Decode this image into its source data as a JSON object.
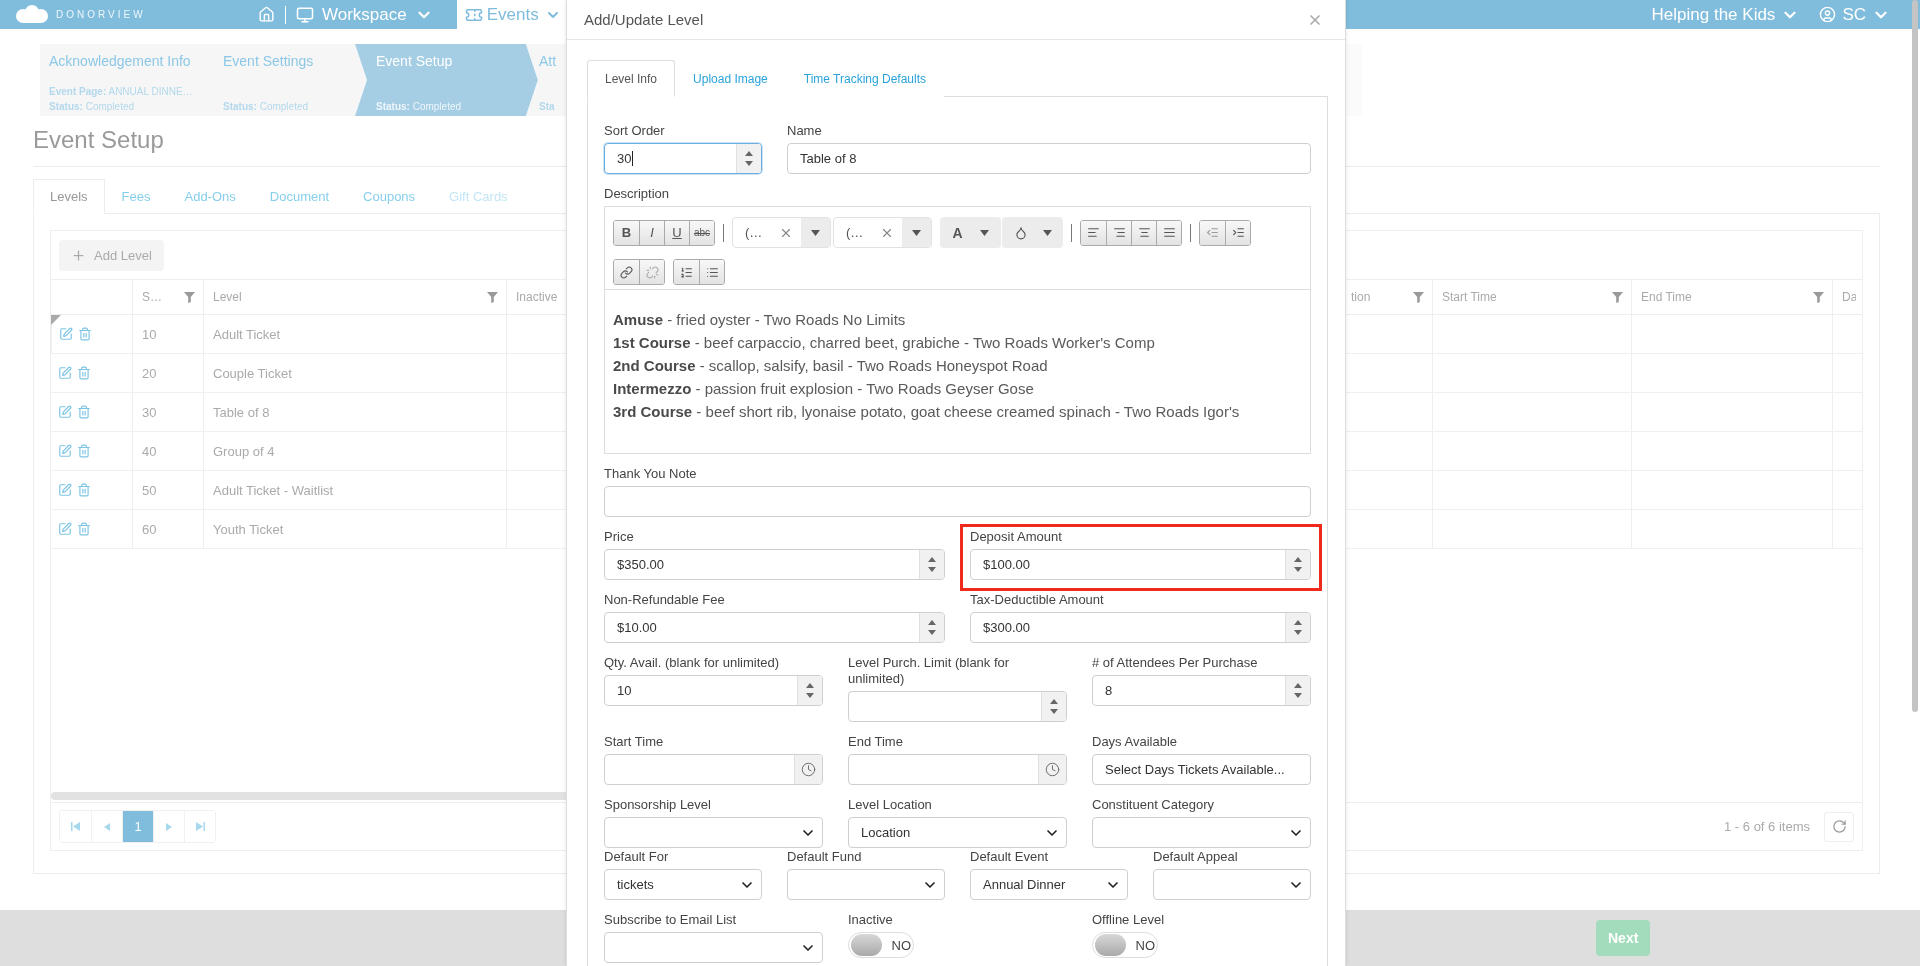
{
  "top_bar": {
    "logo": "DONORVIEW",
    "workspace": "Workspace",
    "events": "Events",
    "organization": "Helping the Kids",
    "user": "SC"
  },
  "wizard": [
    {
      "title": "Acknowledgement Info",
      "details": [
        {
          "label": "Event Page:",
          "value": "ANNUAL DINNE…"
        },
        {
          "label": "Status:",
          "value": "Completed"
        }
      ],
      "selected": false
    },
    {
      "title": "Event Settings",
      "details": [
        {
          "label": "Status:",
          "value": "Completed"
        }
      ],
      "selected": false
    },
    {
      "title": "Event Setup",
      "details": [
        {
          "label": "Status:",
          "value": "Completed"
        }
      ],
      "selected": true
    },
    {
      "title": "Att",
      "details": [
        {
          "label": "Sta"
        }
      ],
      "selected": false
    }
  ],
  "page_title": "Event Setup",
  "tabs": [
    {
      "label": "Levels",
      "selected": true,
      "disabled": false
    },
    {
      "label": "Fees",
      "selected": false,
      "disabled": false
    },
    {
      "label": "Add-Ons",
      "selected": false,
      "disabled": false
    },
    {
      "label": "Document",
      "selected": false,
      "disabled": false
    },
    {
      "label": "Coupons",
      "selected": false,
      "disabled": false
    },
    {
      "label": "Gift Cards",
      "selected": false,
      "disabled": true
    }
  ],
  "add_button": "Add Level",
  "table": {
    "columns": [
      {
        "label": "S…",
        "filter": true
      },
      {
        "label": "Level",
        "filter": true
      },
      {
        "label": "Inactive"
      },
      {
        "label": "tion",
        "filter": true
      },
      {
        "label": "Start Time",
        "filter": true
      },
      {
        "label": "End Time",
        "filter": true
      },
      {
        "label": "Da"
      }
    ],
    "rows": [
      {
        "sort": "10",
        "level": "Adult Ticket",
        "marked": true
      },
      {
        "sort": "20",
        "level": "Couple Ticket",
        "marked": false
      },
      {
        "sort": "30",
        "level": "Table of 8",
        "marked": false
      },
      {
        "sort": "40",
        "level": "Group of 4",
        "marked": false
      },
      {
        "sort": "50",
        "level": "Adult Ticket - Waitlist",
        "marked": false
      },
      {
        "sort": "60",
        "level": "Youth Ticket",
        "marked": false
      }
    ]
  },
  "pager": {
    "pages": [
      {
        "label": "1",
        "selected": true
      }
    ],
    "summary": "1 - 6 of 6 items"
  },
  "footer": {
    "next_button": "Next"
  },
  "modal": {
    "title": "Add/Update Level",
    "tabs": [
      {
        "label": "Level Info",
        "selected": true
      },
      {
        "label": "Upload Image",
        "selected": false
      },
      {
        "label": "Time Tracking Defaults",
        "selected": false
      }
    ],
    "rows": [
      [
        {
          "kind": "number",
          "label": "Sort Order",
          "value": "30",
          "focused": true,
          "highlighted": false
        },
        {
          "kind": "text",
          "label": "Name",
          "value": "Table of 8",
          "focused": false,
          "highlighted": false
        }
      ],
      [
        {
          "kind": "editor",
          "label": "Description",
          "toolbar": {
            "format": [
              "B",
              "I",
              "U",
              "abc"
            ],
            "font_name": "(…",
            "font_size": "(…",
            "font_color": "A"
          },
          "lines": [
            "**Amuse** - fried oyster - Two Roads No Limits",
            "**1st Course** - beef carpaccio, charred beet, grabiche - Two Roads Worker's Comp",
            "**2nd Course** - scallop, salsify, basil - Two Roads Honeyspot Road",
            "**Intermezzo** - passion fruit explosion - Two Roads Geyser Gose",
            "**3rd Course** - beef short rib, lyonaise potato, goat cheese creamed spinach - Two Roads Igor's"
          ]
        }
      ],
      [
        {
          "kind": "text",
          "label": "Thank You Note",
          "focused": false,
          "highlighted": false
        }
      ],
      [
        {
          "kind": "number",
          "label": "Price",
          "value": "$350.00",
          "focused": false,
          "highlighted": false
        },
        {
          "kind": "number",
          "label": "Deposit Amount",
          "value": "$100.00",
          "focused": false,
          "highlighted": true
        }
      ],
      [
        {
          "kind": "number",
          "label": "Non-Refundable Fee",
          "value": "$10.00",
          "focused": false,
          "highlighted": false
        },
        {
          "kind": "number",
          "label": "Tax-Deductible Amount",
          "value": "$300.00",
          "focused": false,
          "highlighted": false
        }
      ],
      [
        {
          "kind": "number",
          "label": "Qty. Avail. (blank for unlimited)",
          "value": "10",
          "focused": false,
          "highlighted": false
        },
        {
          "kind": "number",
          "label": "Level Purch. Limit (blank for unlimited)",
          "focused": false,
          "highlighted": false
        },
        {
          "kind": "number",
          "label": "# of Attendees Per Purchase",
          "value": "8",
          "focused": false,
          "highlighted": false
        }
      ],
      [
        {
          "kind": "time",
          "label": "Start Time",
          "focused": false,
          "highlighted": false
        },
        {
          "kind": "time",
          "label": "End Time",
          "focused": false,
          "highlighted": false
        },
        {
          "kind": "picker",
          "label": "Days Available",
          "value": "Select Days Tickets Available...",
          "focused": false,
          "highlighted": false
        }
      ],
      [
        {
          "kind": "select",
          "label": "Sponsorship Level",
          "focused": false,
          "highlighted": false
        },
        {
          "kind": "select",
          "label": "Level Location",
          "value": "Location",
          "focused": false,
          "highlighted": false
        },
        {
          "kind": "select",
          "label": "Constituent Category",
          "focused": false,
          "highlighted": false
        }
      ],
      [
        {
          "kind": "select",
          "label": "Default For",
          "value": "tickets",
          "focused": false,
          "highlighted": false
        },
        {
          "kind": "select",
          "label": "Default Fund",
          "focused": false,
          "highlighted": false
        },
        {
          "kind": "select",
          "label": "Default Event",
          "value": "Annual Dinner",
          "focused": false,
          "highlighted": false
        },
        {
          "kind": "select",
          "label": "Default Appeal",
          "focused": false,
          "highlighted": false
        }
      ],
      [
        {
          "kind": "select",
          "label": "Subscribe to Email List",
          "focused": false,
          "highlighted": false
        },
        {
          "kind": "toggle",
          "label": "Inactive",
          "on": false,
          "text": "NO",
          "highlighted": false
        },
        {
          "kind": "toggle",
          "label": "Offline Level",
          "on": false,
          "text": "NO",
          "highlighted": false
        }
      ]
    ]
  }
}
